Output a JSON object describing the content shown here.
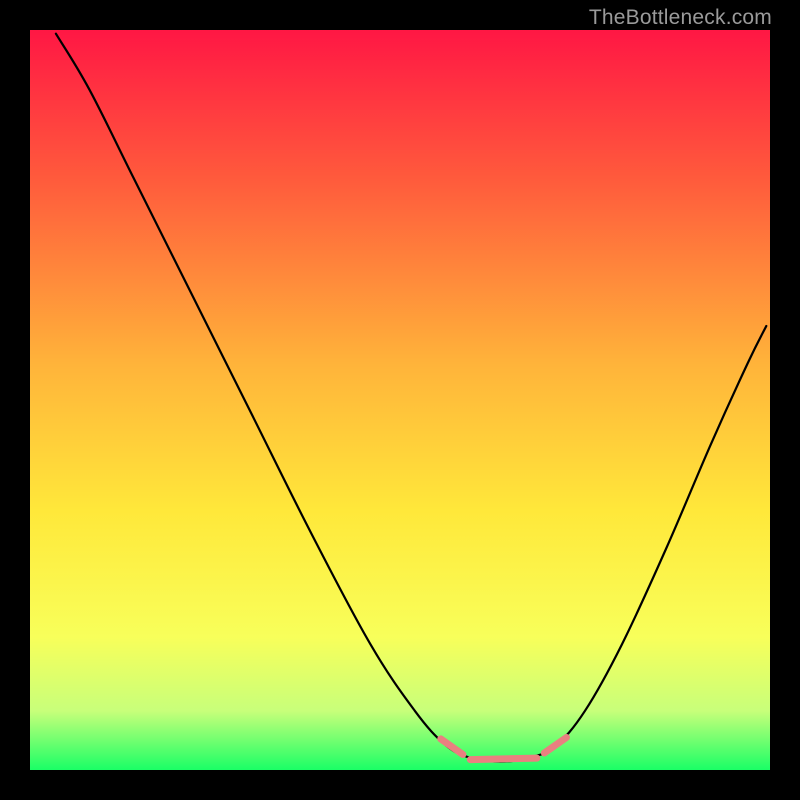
{
  "watermark": "TheBottleneck.com",
  "chart_data": {
    "type": "line",
    "title": "",
    "xlabel": "",
    "ylabel": "",
    "xlim": [
      0,
      100
    ],
    "ylim": [
      0,
      100
    ],
    "gradient_stops": [
      {
        "offset": 0,
        "color": "#ff1744"
      },
      {
        "offset": 20,
        "color": "#ff5a3c"
      },
      {
        "offset": 45,
        "color": "#ffb33a"
      },
      {
        "offset": 65,
        "color": "#ffe83a"
      },
      {
        "offset": 82,
        "color": "#f8ff5a"
      },
      {
        "offset": 92,
        "color": "#c8ff7a"
      },
      {
        "offset": 100,
        "color": "#1aff66"
      }
    ],
    "series": [
      {
        "name": "curve",
        "stroke": "#000000",
        "stroke_width": 2.2,
        "points": [
          {
            "x": 3.5,
            "y": 99.5
          },
          {
            "x": 8,
            "y": 92
          },
          {
            "x": 14,
            "y": 80
          },
          {
            "x": 22,
            "y": 64
          },
          {
            "x": 30,
            "y": 48
          },
          {
            "x": 38,
            "y": 32
          },
          {
            "x": 46,
            "y": 17
          },
          {
            "x": 52,
            "y": 8
          },
          {
            "x": 56,
            "y": 3.5
          },
          {
            "x": 59,
            "y": 1.8
          },
          {
            "x": 62,
            "y": 1.2
          },
          {
            "x": 65,
            "y": 1.2
          },
          {
            "x": 68,
            "y": 1.8
          },
          {
            "x": 71,
            "y": 3.2
          },
          {
            "x": 75,
            "y": 8
          },
          {
            "x": 80,
            "y": 17
          },
          {
            "x": 86,
            "y": 30
          },
          {
            "x": 92,
            "y": 44
          },
          {
            "x": 97,
            "y": 55
          },
          {
            "x": 99.5,
            "y": 60
          }
        ]
      },
      {
        "name": "bottom-mark-left",
        "stroke": "#e98080",
        "stroke_width": 7,
        "points": [
          {
            "x": 55.5,
            "y": 4.2
          },
          {
            "x": 58.5,
            "y": 2.1
          }
        ]
      },
      {
        "name": "bottom-mark-flat",
        "stroke": "#e98080",
        "stroke_width": 7,
        "points": [
          {
            "x": 59.5,
            "y": 1.4
          },
          {
            "x": 68.5,
            "y": 1.6
          }
        ]
      },
      {
        "name": "bottom-mark-right",
        "stroke": "#e98080",
        "stroke_width": 7,
        "points": [
          {
            "x": 69.5,
            "y": 2.3
          },
          {
            "x": 72.5,
            "y": 4.4
          }
        ]
      }
    ]
  }
}
